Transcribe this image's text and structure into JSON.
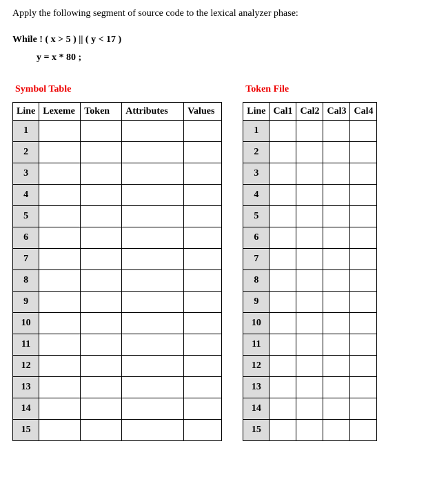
{
  "instruction": "Apply the following segment of source code to the lexical analyzer phase:",
  "code": {
    "line1": "While  ! ( x > 5 ) || ( y < 17 )",
    "line2": "y = x * 80 ;"
  },
  "symbolTable": {
    "title": "Symbol Table",
    "headers": [
      "Line",
      "Lexeme",
      "Token",
      "Attributes",
      "Values"
    ],
    "rows": [
      "1",
      "2",
      "3",
      "4",
      "5",
      "6",
      "7",
      "8",
      "9",
      "10",
      "11",
      "12",
      "13",
      "14",
      "15"
    ]
  },
  "tokenFile": {
    "title": "Token File",
    "headers": [
      "Line",
      "Cal1",
      "Cal2",
      "Cal3",
      "Cal4"
    ],
    "rows": [
      "1",
      "2",
      "3",
      "4",
      "5",
      "6",
      "7",
      "8",
      "9",
      "10",
      "11",
      "12",
      "13",
      "14",
      "15"
    ]
  }
}
